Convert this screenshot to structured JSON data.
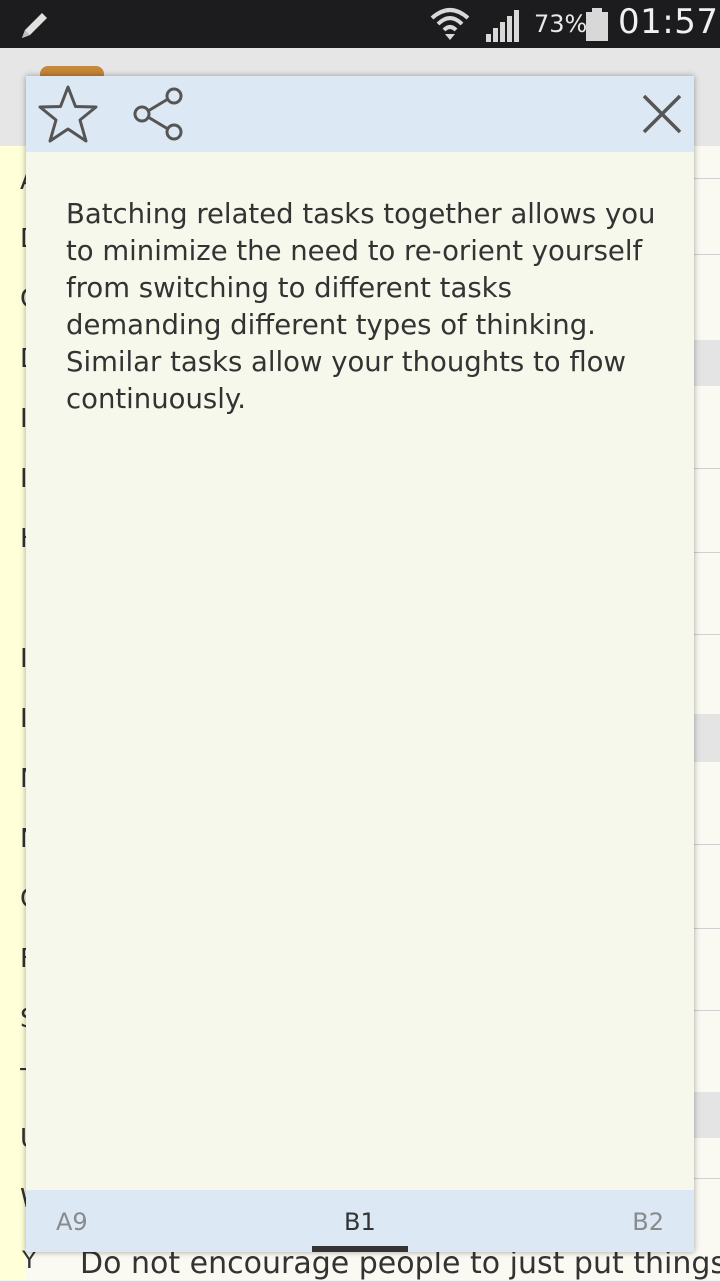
{
  "status_bar": {
    "battery_percent": "73%",
    "time": "01:57"
  },
  "background": {
    "left_letters": [
      "A",
      "D",
      "C",
      "D",
      "I",
      "I",
      "H",
      "I",
      "I",
      "M",
      "N",
      "C",
      "F",
      "S",
      "T",
      "U",
      "W"
    ],
    "bottom_item_text": "Do not encourage people to just put things…",
    "bottom_letter": "Y"
  },
  "dialog": {
    "body_text": "Batching related tasks together allows you to minimize the need to re-orient yourself from switching to different tasks demanding different types of thinking. Similar tasks allow your thoughts to flow continuously.",
    "footer": {
      "prev": "A9",
      "current": "B1",
      "next": "B2"
    }
  },
  "icons": {
    "favorite": "star-icon",
    "share": "share-icon",
    "close": "close-icon"
  }
}
